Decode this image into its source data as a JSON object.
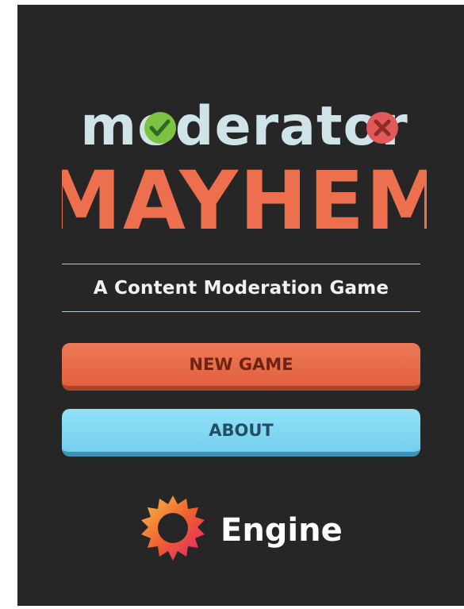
{
  "logo": {
    "line1": "moderator",
    "line2": "MAYHEM",
    "line1_color": "#cfe3e8",
    "line2_color": "#ee6f4e",
    "check_color": "#7cc243",
    "x_color": "#e05a5a"
  },
  "subtitle": "A Content Moderation Game",
  "buttons": {
    "new_game": "NEW GAME",
    "about": "ABOUT"
  },
  "sponsor": {
    "name": "Engine"
  }
}
